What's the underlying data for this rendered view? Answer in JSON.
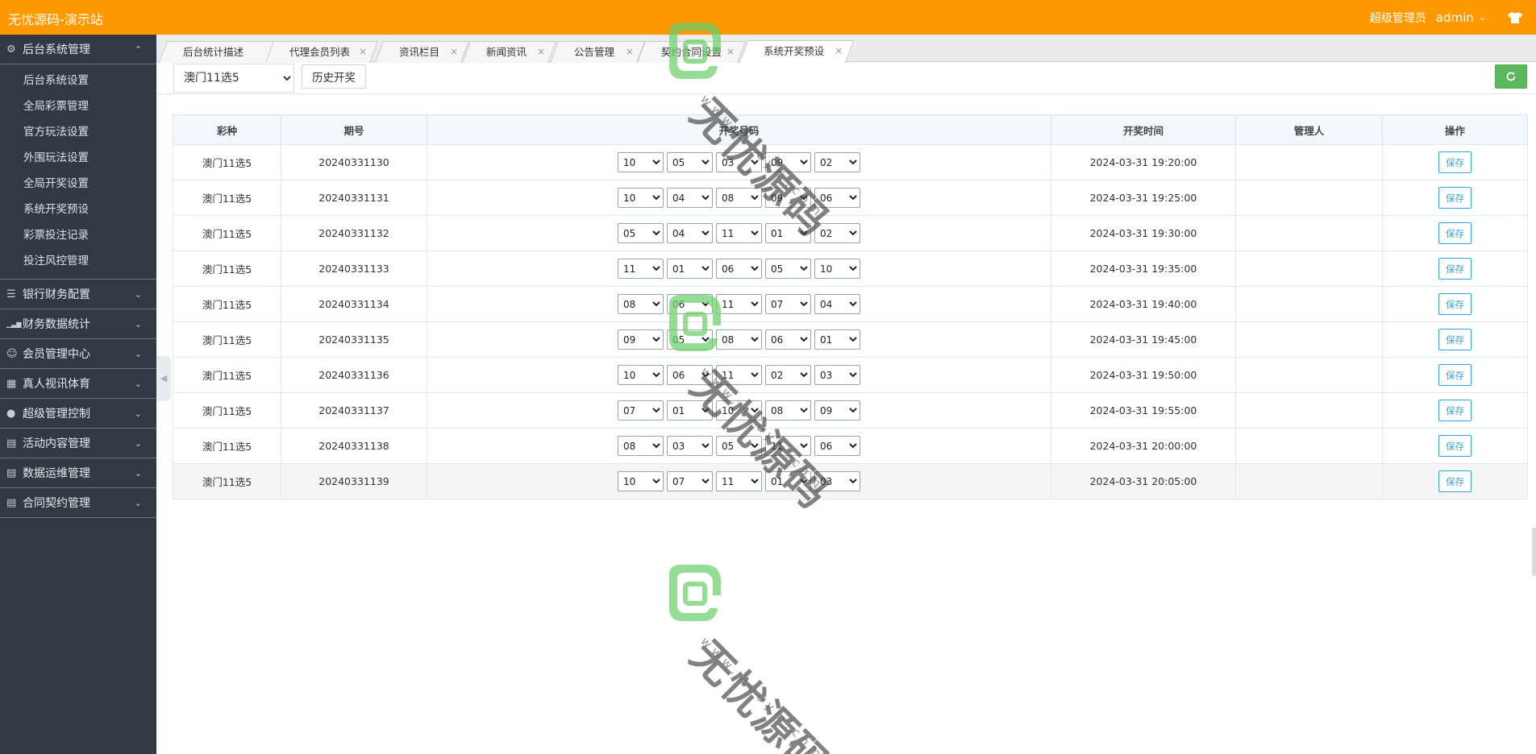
{
  "header": {
    "brand": "无忧源码-演示站",
    "role": "超级管理员",
    "user": "admin"
  },
  "sidebar": {
    "groups": [
      {
        "label": "后台系统管理",
        "icon": "gear-icon",
        "expanded": true,
        "items": [
          {
            "label": "后台系统设置"
          },
          {
            "label": "全局彩票管理"
          },
          {
            "label": "官方玩法设置"
          },
          {
            "label": "外围玩法设置"
          },
          {
            "label": "全局开奖设置"
          },
          {
            "label": "系统开奖预设"
          },
          {
            "label": "彩票投注记录"
          },
          {
            "label": "投注风控管理"
          }
        ]
      },
      {
        "label": "银行财务配置",
        "icon": "list-icon",
        "expanded": false
      },
      {
        "label": "财务数据统计",
        "icon": "bar-chart-icon",
        "expanded": false
      },
      {
        "label": "会员管理中心",
        "icon": "user-icon",
        "expanded": false
      },
      {
        "label": "真人视讯体育",
        "icon": "grid-icon",
        "expanded": false
      },
      {
        "label": "超级管理控制",
        "icon": "admin-user-icon",
        "expanded": false
      },
      {
        "label": "活动内容管理",
        "icon": "document-icon",
        "expanded": false
      },
      {
        "label": "数据运维管理",
        "icon": "document-icon",
        "expanded": false
      },
      {
        "label": "合同契约管理",
        "icon": "document-icon",
        "expanded": false
      }
    ]
  },
  "tabs": [
    {
      "label": "后台统计描述",
      "closable": false
    },
    {
      "label": "代理会员列表",
      "closable": true
    },
    {
      "label": "资讯栏目",
      "closable": true
    },
    {
      "label": "新闻资讯",
      "closable": true
    },
    {
      "label": "公告管理",
      "closable": true
    },
    {
      "label": "契约合同设置",
      "closable": true
    },
    {
      "label": "系统开奖预设",
      "closable": true,
      "active": true
    }
  ],
  "toolbar": {
    "lottery_selected": "澳门11选5",
    "history_label": "历史开奖"
  },
  "table": {
    "headers": [
      "彩种",
      "期号",
      "开奖号码",
      "开奖时间",
      "管理人",
      "操作"
    ],
    "save_label": "保存",
    "rows": [
      {
        "lottery": "澳门11选5",
        "issue": "20240331130",
        "numbers": [
          "10",
          "05",
          "03",
          "09",
          "02"
        ],
        "time": "2024-03-31 19:20:00",
        "manager": ""
      },
      {
        "lottery": "澳门11选5",
        "issue": "20240331131",
        "numbers": [
          "10",
          "04",
          "08",
          "09",
          "06"
        ],
        "time": "2024-03-31 19:25:00",
        "manager": ""
      },
      {
        "lottery": "澳门11选5",
        "issue": "20240331132",
        "numbers": [
          "05",
          "04",
          "11",
          "01",
          "02"
        ],
        "time": "2024-03-31 19:30:00",
        "manager": ""
      },
      {
        "lottery": "澳门11选5",
        "issue": "20240331133",
        "numbers": [
          "11",
          "01",
          "06",
          "05",
          "10"
        ],
        "time": "2024-03-31 19:35:00",
        "manager": ""
      },
      {
        "lottery": "澳门11选5",
        "issue": "20240331134",
        "numbers": [
          "08",
          "06",
          "11",
          "07",
          "04"
        ],
        "time": "2024-03-31 19:40:00",
        "manager": ""
      },
      {
        "lottery": "澳门11选5",
        "issue": "20240331135",
        "numbers": [
          "09",
          "05",
          "08",
          "06",
          "01"
        ],
        "time": "2024-03-31 19:45:00",
        "manager": ""
      },
      {
        "lottery": "澳门11选5",
        "issue": "20240331136",
        "numbers": [
          "10",
          "06",
          "11",
          "02",
          "03"
        ],
        "time": "2024-03-31 19:50:00",
        "manager": ""
      },
      {
        "lottery": "澳门11选5",
        "issue": "20240331137",
        "numbers": [
          "07",
          "01",
          "10",
          "08",
          "09"
        ],
        "time": "2024-03-31 19:55:00",
        "manager": ""
      },
      {
        "lottery": "澳门11选5",
        "issue": "20240331138",
        "numbers": [
          "08",
          "03",
          "05",
          "11",
          "06"
        ],
        "time": "2024-03-31 20:00:00",
        "manager": ""
      },
      {
        "lottery": "澳门11选5",
        "issue": "20240331139",
        "numbers": [
          "10",
          "07",
          "11",
          "01",
          "03"
        ],
        "time": "2024-03-31 20:05:00",
        "manager": ""
      }
    ]
  },
  "watermark": {
    "text": "无忧源码",
    "url": "www.wuuym.com"
  },
  "colors": {
    "header": "#ff9900",
    "sidebar": "#2f3a44",
    "refresh": "#5cb85c",
    "save": "#39a3dd",
    "watermark_logo": "#6dcf6d"
  }
}
